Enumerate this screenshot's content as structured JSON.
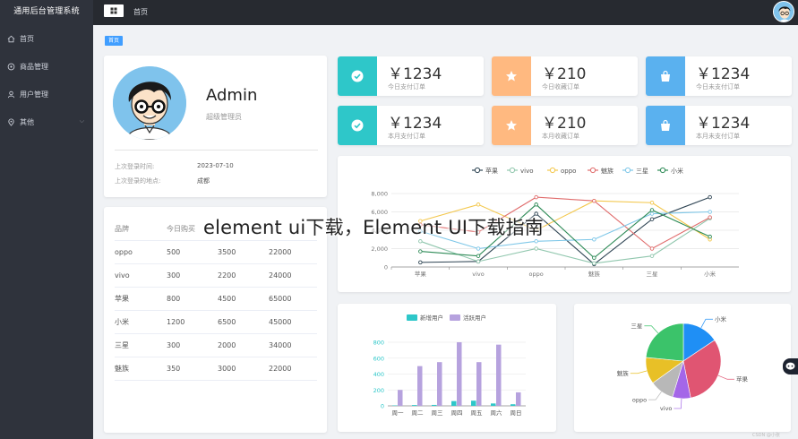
{
  "app": {
    "brand": "通用后台管理系统",
    "header_title": "首页"
  },
  "sidebar": {
    "items": [
      {
        "label": "首页",
        "icon": "home-icon"
      },
      {
        "label": "商品管理",
        "icon": "goods-icon"
      },
      {
        "label": "用户管理",
        "icon": "user-icon"
      },
      {
        "label": "其他",
        "icon": "location-icon"
      }
    ]
  },
  "tags": [
    "首页"
  ],
  "profile": {
    "name": "Admin",
    "role": "超级管理员",
    "last_login_time_label": "上次登录时间:",
    "last_login_time": "2023-07-10",
    "last_login_place_label": "上次登录的地点:",
    "last_login_place": "成都"
  },
  "table": {
    "headers": [
      "品牌",
      "今日购买",
      "",
      ""
    ],
    "rows": [
      [
        "oppo",
        "500",
        "3500",
        "22000"
      ],
      [
        "vivo",
        "300",
        "2200",
        "24000"
      ],
      [
        "苹果",
        "800",
        "4500",
        "65000"
      ],
      [
        "小米",
        "1200",
        "6500",
        "45000"
      ],
      [
        "三星",
        "300",
        "2000",
        "34000"
      ],
      [
        "魅族",
        "350",
        "3000",
        "22000"
      ]
    ]
  },
  "stats": [
    {
      "value": "￥1234",
      "label": "今日支付订单",
      "color": "#2ec7c9",
      "icon": "check-circle-icon"
    },
    {
      "value": "￥210",
      "label": "今日收藏订单",
      "color": "#ffb980",
      "icon": "star-icon"
    },
    {
      "value": "￥1234",
      "label": "今日未支付订单",
      "color": "#5ab1ef",
      "icon": "shopping-bag-icon"
    },
    {
      "value": "￥1234",
      "label": "本月支付订单",
      "color": "#2ec7c9",
      "icon": "check-circle-icon"
    },
    {
      "value": "￥210",
      "label": "本月收藏订单",
      "color": "#ffb980",
      "icon": "star-icon"
    },
    {
      "value": "￥1234",
      "label": "本月未支付订单",
      "color": "#5ab1ef",
      "icon": "shopping-bag-icon"
    }
  ],
  "overlay_title": "element ui下载，Element UI下载指南",
  "watermark": "CSDN @小张",
  "chart_data": [
    {
      "type": "line",
      "categories": [
        "苹果",
        "vivo",
        "oppo",
        "魅族",
        "三星",
        "小米"
      ],
      "ylim": [
        0,
        8000
      ],
      "yticks": [
        "0",
        "2,000",
        "4,000",
        "6,000",
        "8,000"
      ],
      "legend_position": "top",
      "series": [
        {
          "name": "苹果",
          "color": "#2f4554",
          "values": [
            500,
            600,
            5800,
            300,
            5200,
            7600
          ]
        },
        {
          "name": "vivo",
          "color": "#91c7ae",
          "values": [
            2800,
            600,
            2000,
            400,
            1200,
            5300
          ]
        },
        {
          "name": "oppo",
          "color": "#f3c74b",
          "values": [
            5000,
            6800,
            4000,
            7200,
            7000,
            3000
          ]
        },
        {
          "name": "魅族",
          "color": "#e06c6c",
          "values": [
            4600,
            3800,
            7600,
            7200,
            2000,
            5400
          ]
        },
        {
          "name": "三星",
          "color": "#7ec7e8",
          "values": [
            3900,
            2000,
            2800,
            3000,
            5800,
            6000
          ]
        },
        {
          "name": "小米",
          "color": "#2e8b57",
          "values": [
            1700,
            1200,
            6800,
            1000,
            6200,
            3300
          ]
        }
      ]
    },
    {
      "type": "bar",
      "categories": [
        "周一",
        "周二",
        "周三",
        "周四",
        "周五",
        "周六",
        "周日"
      ],
      "ylim": [
        0,
        800
      ],
      "yticks": [
        "0",
        "200",
        "400",
        "600",
        "800"
      ],
      "legend_position": "top",
      "series": [
        {
          "name": "新增用户",
          "color": "#2ec7c9",
          "values": [
            5,
            10,
            12,
            60,
            65,
            30,
            20
          ]
        },
        {
          "name": "活跃用户",
          "color": "#b6a2de",
          "values": [
            200,
            500,
            550,
            800,
            550,
            770,
            170
          ]
        }
      ]
    },
    {
      "type": "pie",
      "slices": [
        {
          "label": "小米",
          "value": 2999,
          "color": "#1f8ff5"
        },
        {
          "label": "苹果",
          "value": 5999,
          "color": "#e05572"
        },
        {
          "label": "vivo",
          "value": 1500,
          "color": "#a466e8"
        },
        {
          "label": "oppo",
          "value": 1999,
          "color": "#b8b8b8"
        },
        {
          "label": "魅族",
          "value": 2200,
          "color": "#e8c027"
        },
        {
          "label": "三星",
          "value": 4500,
          "color": "#3bc36a"
        }
      ]
    }
  ]
}
